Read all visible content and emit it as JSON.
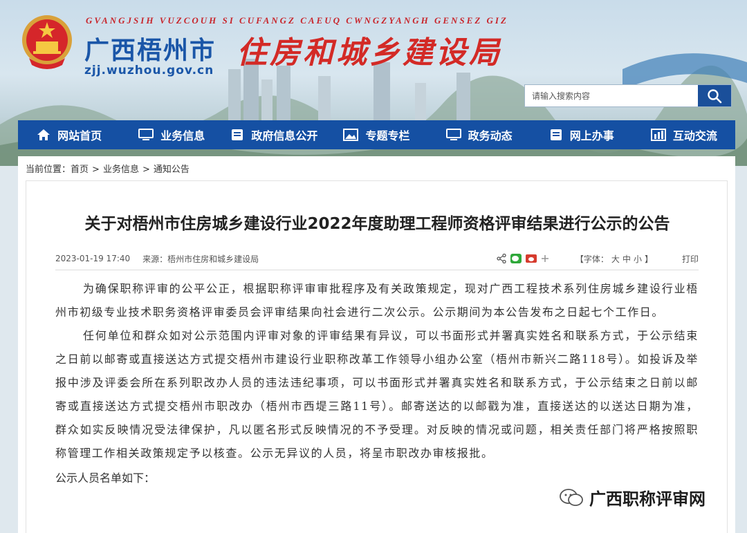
{
  "header": {
    "romanized_title": "GVANGJSIH VUZCOUH SI CUFANGZ CAEUQ CWNGZYANGH GENSEZ GIZ",
    "city_name": "广西梧州市",
    "department_name": "住房和城乡建设局",
    "site_url": "zjj.wuzhou.gov.cn",
    "search": {
      "placeholder": "请输入搜索内容"
    }
  },
  "nav": {
    "items": [
      {
        "label": "网站首页",
        "icon": "home-icon"
      },
      {
        "label": "业务信息",
        "icon": "monitor-icon"
      },
      {
        "label": "政府信息公开",
        "icon": "document-icon"
      },
      {
        "label": "专题专栏",
        "icon": "image-icon"
      },
      {
        "label": "政务动态",
        "icon": "monitor-icon"
      },
      {
        "label": "网上办事",
        "icon": "document-icon"
      },
      {
        "label": "互动交流",
        "icon": "bar-chart-icon"
      }
    ]
  },
  "breadcrumb": {
    "prefix": "当前位置：",
    "items": [
      "首页",
      "业务信息",
      "通知公告"
    ],
    "separator": ">"
  },
  "article": {
    "title": "关于对梧州市住房城乡建设行业2022年度助理工程师资格评审结果进行公示的公告",
    "date": "2023-01-19 17:40",
    "source": "来源：梧州市住房和城乡建设局",
    "font_control": {
      "label": "【字体：",
      "large": "大",
      "medium": "中",
      "small": "小",
      "close": "】"
    },
    "print_label": "打印",
    "paragraphs": [
      "为确保职称评审的公平公正，根据职称评审审批程序及有关政策规定，现对广西工程技术系列住房城乡建设行业梧州市初级专业技术职务资格评审委员会评审结果向社会进行二次公示。公示期间为本公告发布之日起七个工作日。",
      "任何单位和群众如对公示范围内评审对象的评审结果有异议，可以书面形式并署真实姓名和联系方式，于公示结束之日前以邮寄或直接送达方式提交梧州市建设行业职称改革工作领导小组办公室（梧州市新兴二路118号）。如投诉及举报中涉及评委会所在系列职改办人员的违法违纪事项，可以书面形式并署真实姓名和联系方式，于公示结束之日前以邮寄或直接送达方式提交梧州市职改办（梧州市西堤三路11号）。邮寄送达的以邮戳为准，直接送达的以送达日期为准，群众如实反映情况受法律保护，凡以匿名形式反映情况的不予受理。对反映的情况或问题，相关责任部门将严格按照职称管理工作相关政策规定予以核查。公示无异议的人员，将呈市职改办审核报批。"
    ],
    "list_heading": "公示人员名单如下："
  },
  "watermark": {
    "text": "广西职称评审网"
  },
  "colors": {
    "brand_blue": "#1550a3",
    "title_red": "#d32a26",
    "city_blue": "#1a56a8"
  }
}
